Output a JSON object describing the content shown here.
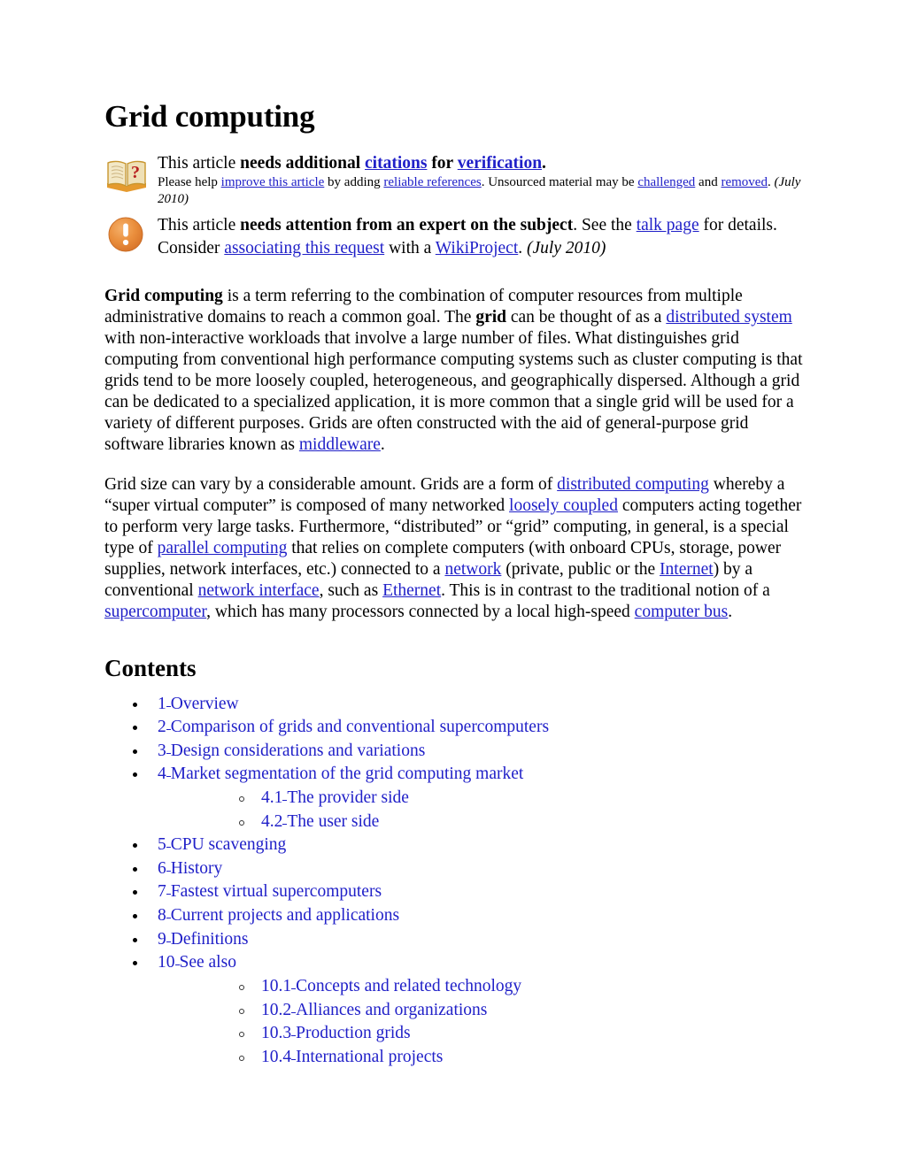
{
  "article": {
    "title": "Grid computing"
  },
  "notices": [
    {
      "icon": "book-question-icon",
      "lead_1": "This article ",
      "lead_bold": "needs additional ",
      "link_citations": "citations",
      "lead_2": " for ",
      "link_verification": "verification",
      "lead_3": ".",
      "detail_1": "Please help ",
      "link_improve": "improve this article",
      "detail_2": " by adding ",
      "link_reliable": "reliable references",
      "detail_3": ". Unsourced material may be ",
      "link_challenged": "challenged",
      "detail_4": " and ",
      "link_removed": "removed",
      "detail_5": ". ",
      "date": "(July 2010)"
    },
    {
      "icon": "exclamation-circle-icon",
      "lead_1": "This article ",
      "lead_bold": "needs attention from an expert on the subject",
      "lead_2": ". See the ",
      "link_talk": "talk page",
      "lead_3": " for details. Consider ",
      "link_associate": "associating this request",
      "lead_4": " with a ",
      "link_wikiproject": "WikiProject",
      "lead_5": ". ",
      "date": "(July 2010)"
    }
  ],
  "paragraphs": {
    "p1": {
      "bold_term": "Grid computing",
      "t1": " is a term referring to the combination of computer resources from multiple administrative domains to reach a common goal. The ",
      "bold_grid": "grid",
      "t2": " can be thought of as a ",
      "link_distributed_system": "distributed system",
      "t3": " with non-interactive workloads that involve a large number of files. What distinguishes grid computing from conventional high performance computing systems such as cluster computing is that grids tend to be more loosely coupled, heterogeneous, and geographically dispersed. Although a grid can be dedicated to a specialized application, it is more common that a single grid will be used for a variety of different purposes. Grids are often constructed with the aid of general-purpose grid software libraries known as ",
      "link_middleware": "middleware",
      "t4": "."
    },
    "p2": {
      "t1": "Grid size can vary by a considerable amount. Grids are a form of ",
      "link_distributed_computing": "distributed computing",
      "t2": " whereby a “super virtual computer” is composed of many networked ",
      "link_loosely_coupled": "loosely coupled",
      "t3": " computers acting together to perform very large tasks. Furthermore, “distributed” or “grid” computing, in general, is a special type of ",
      "link_parallel_computing": "parallel computing",
      "t4": " that relies on complete computers (with onboard CPUs, storage, power supplies, network interfaces, etc.) connected to a ",
      "link_network": "network",
      "t5": " (private, public or the ",
      "link_internet": "Internet",
      "t6": ") by a conventional ",
      "link_network_interface": "network interface",
      "t7": ", such as ",
      "link_ethernet": "Ethernet",
      "t8": ". This is in contrast to the traditional notion of a ",
      "link_supercomputer": "supercomputer",
      "t9": ", which has many processors connected by a local high-speed ",
      "link_computer_bus": "computer bus",
      "t10": "."
    }
  },
  "contents": {
    "heading": "Contents",
    "items": [
      {
        "num": "1",
        "label": "Overview",
        "sub": []
      },
      {
        "num": "2",
        "label": "Comparison of grids and conventional supercomputers",
        "sub": []
      },
      {
        "num": "3",
        "label": "Design considerations and variations",
        "sub": []
      },
      {
        "num": "4",
        "label": "Market segmentation of the grid computing market",
        "sub": [
          {
            "num": "4.1",
            "label": "The provider side"
          },
          {
            "num": "4.2",
            "label": "The user side"
          }
        ]
      },
      {
        "num": "5",
        "label": "CPU scavenging",
        "sub": []
      },
      {
        "num": "6",
        "label": "History",
        "sub": []
      },
      {
        "num": "7",
        "label": "Fastest virtual supercomputers",
        "sub": []
      },
      {
        "num": "8",
        "label": "Current projects and applications",
        "sub": []
      },
      {
        "num": "9",
        "label": "Definitions",
        "sub": []
      },
      {
        "num": "10",
        "label": "See also",
        "sub": [
          {
            "num": "10.1",
            "label": "Concepts and related technology"
          },
          {
            "num": "10.2",
            "label": "Alliances and organizations"
          },
          {
            "num": "10.3",
            "label": "Production grids"
          },
          {
            "num": "10.4",
            "label": "International projects"
          }
        ]
      }
    ]
  },
  "colors": {
    "link": "#2020c8",
    "text": "#000000",
    "background": "#ffffff",
    "notice_icon_orange": "#e8923c",
    "notice_book_page": "#f2e6c2"
  }
}
